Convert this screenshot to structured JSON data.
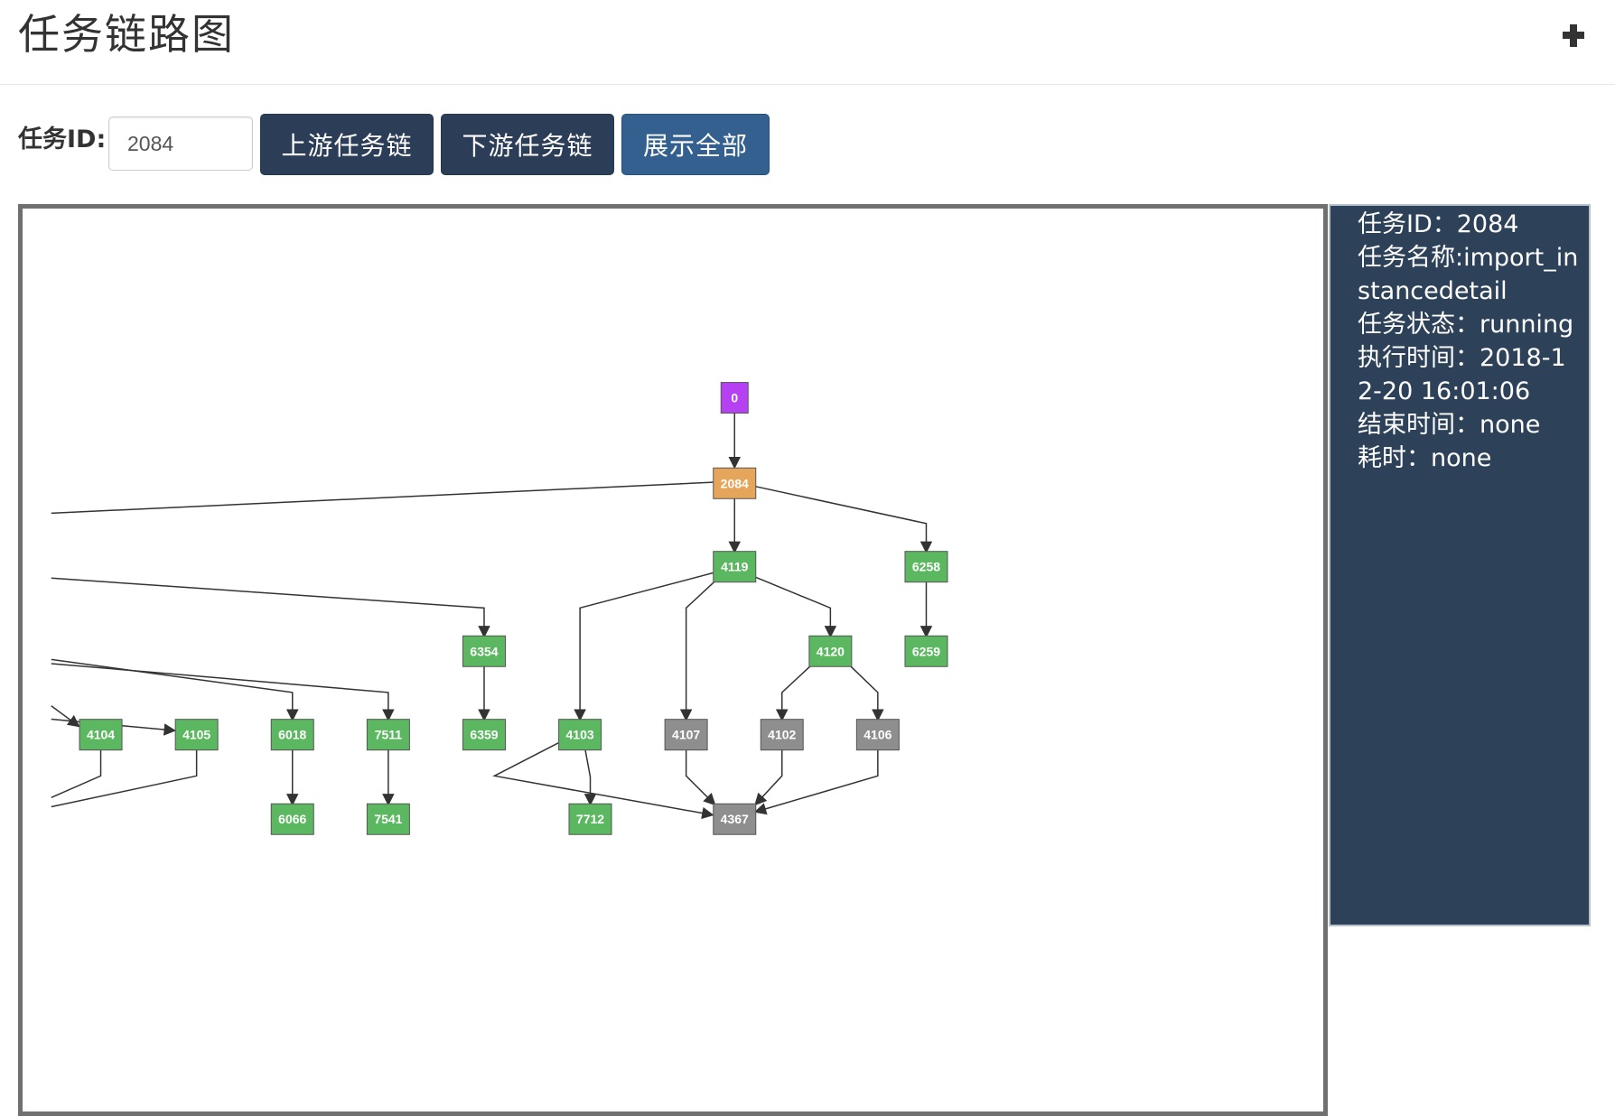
{
  "header": {
    "title": "任务链路图"
  },
  "toolbar": {
    "id_label": "任务ID:",
    "id_value": "2084",
    "upstream_label": "上游任务链",
    "downstream_label": "下游任务链",
    "show_all_label": "展示全部"
  },
  "colors": {
    "root_node": "#b541f2",
    "current_node": "#e5a55a",
    "running_node": "#5cb860",
    "pending_node": "#8e8e8e",
    "button_dark": "#2c3e57",
    "button_active": "#33608f",
    "info_panel_bg": "#2d4159"
  },
  "info": {
    "task_id": "任务ID：2084",
    "task_name": "任务名称:import_instancedetail",
    "task_status": "任务状态：running",
    "exec_time": "执行时间：2018-12-20 16:01:06",
    "end_time": "结束时间：none",
    "duration": "耗时：none"
  },
  "graph": {
    "nodes": [
      {
        "id": "0",
        "status": "root"
      },
      {
        "id": "2084",
        "status": "current"
      },
      {
        "id": "4119",
        "status": "done"
      },
      {
        "id": "6258",
        "status": "done"
      },
      {
        "id": "6354",
        "status": "done"
      },
      {
        "id": "4120",
        "status": "done"
      },
      {
        "id": "6259",
        "status": "done"
      },
      {
        "id": "4104",
        "status": "done"
      },
      {
        "id": "4105",
        "status": "done"
      },
      {
        "id": "6018",
        "status": "done"
      },
      {
        "id": "7511",
        "status": "done"
      },
      {
        "id": "6359",
        "status": "done"
      },
      {
        "id": "4103",
        "status": "done"
      },
      {
        "id": "4107",
        "status": "pending"
      },
      {
        "id": "4102",
        "status": "pending"
      },
      {
        "id": "4106",
        "status": "pending"
      },
      {
        "id": "6066",
        "status": "done"
      },
      {
        "id": "7541",
        "status": "done"
      },
      {
        "id": "7712",
        "status": "done"
      },
      {
        "id": "4367",
        "status": "pending"
      }
    ]
  }
}
